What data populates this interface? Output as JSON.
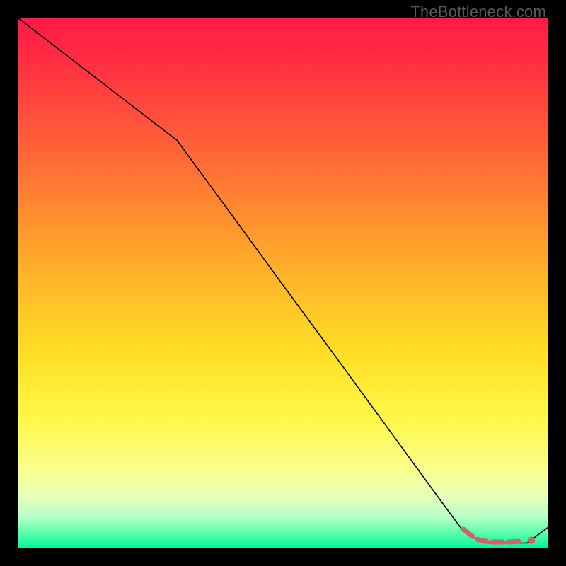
{
  "watermark": "TheBottleneck.com",
  "chart_data": {
    "type": "line",
    "title": "",
    "xlabel": "",
    "ylabel": "",
    "xlim": [
      0,
      100
    ],
    "ylim": [
      0,
      100
    ],
    "grid": false,
    "legend": false,
    "series": [
      {
        "name": "curve",
        "color": "#000000",
        "x": [
          0,
          10,
          20,
          30,
          40,
          50,
          60,
          70,
          80,
          84,
          88,
          92,
          96,
          100
        ],
        "y": [
          100,
          92.3,
          84.6,
          76.9,
          63.3,
          49.6,
          36.0,
          22.3,
          8.6,
          3.2,
          1.0,
          1.0,
          1.0,
          4.0
        ]
      }
    ],
    "markers": {
      "name": "end-dashes",
      "color": "#cc6666",
      "segments": [
        {
          "x1": 84.0,
          "y1": 3.6,
          "x2": 85.8,
          "y2": 2.2
        },
        {
          "x1": 86.6,
          "y1": 1.7,
          "x2": 88.4,
          "y2": 1.3
        },
        {
          "x1": 89.4,
          "y1": 1.2,
          "x2": 91.4,
          "y2": 1.2
        },
        {
          "x1": 92.4,
          "y1": 1.2,
          "x2": 94.4,
          "y2": 1.3
        }
      ],
      "dot": {
        "x": 96.8,
        "y": 1.5,
        "r": 0.7
      }
    },
    "gradient_stops": [
      {
        "pos": 0,
        "color": "#ff1a46"
      },
      {
        "pos": 50,
        "color": "#ffb828"
      },
      {
        "pos": 76,
        "color": "#fff84a"
      },
      {
        "pos": 100,
        "color": "#00f59b"
      }
    ]
  }
}
